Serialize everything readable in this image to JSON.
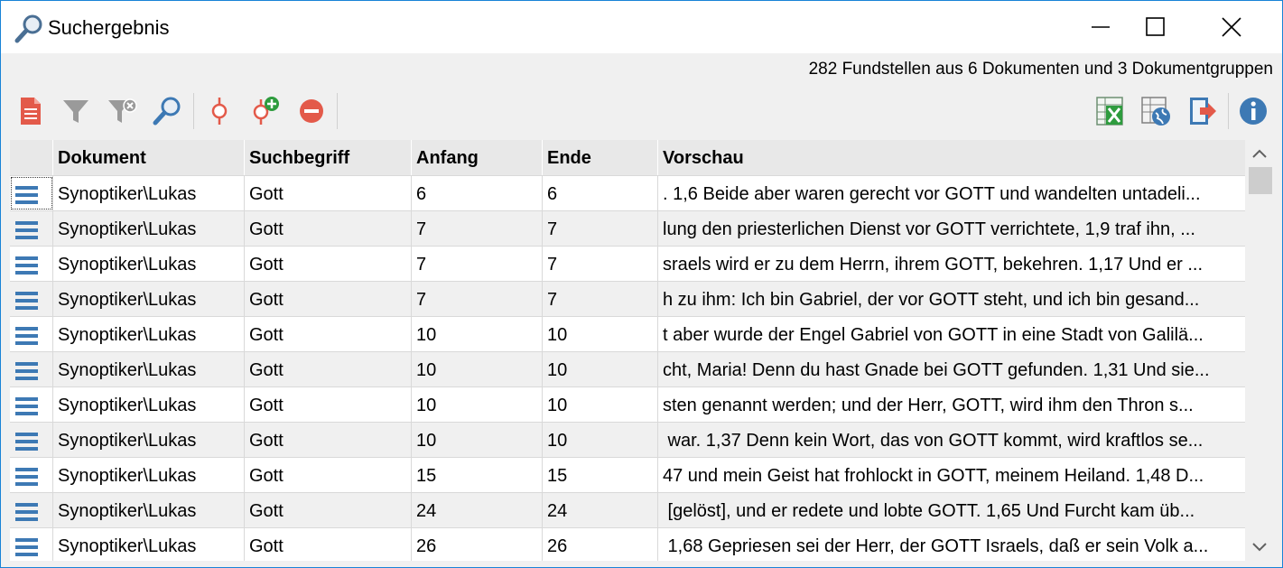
{
  "window": {
    "title": "Suchergebnis",
    "controls": [
      "minimize",
      "maximize",
      "close"
    ]
  },
  "summary": "282 Fundstellen aus 6 Dokumenten und 3 Dokumentgruppen",
  "toolbar": {
    "left_icons": [
      "document-list-icon",
      "filter-icon",
      "filter-remove-icon",
      "search-icon",
      "search-point-icon",
      "search-point-add-icon",
      "remove-icon"
    ],
    "right_icons": [
      "excel-export-icon",
      "web-export-icon",
      "export-arrow-icon",
      "info-icon"
    ]
  },
  "colors": {
    "accent_blue": "#3d79b4",
    "red": "#e35a4a",
    "green": "#2e9c3e",
    "border": "#1883d7"
  },
  "table": {
    "columns": [
      "",
      "Dokument",
      "Suchbegriff",
      "Anfang",
      "Ende",
      "Vorschau"
    ],
    "rows": [
      {
        "dokument": "Synoptiker\\Lukas",
        "suchbegriff": "Gott",
        "anfang": "6",
        "ende": "6",
        "vorschau": ". 1,6 Beide aber waren gerecht vor GOTT und wandelten untadeli..."
      },
      {
        "dokument": "Synoptiker\\Lukas",
        "suchbegriff": "Gott",
        "anfang": "7",
        "ende": "7",
        "vorschau": "lung den priesterlichen Dienst vor GOTT verrichtete, 1,9 traf ihn, ..."
      },
      {
        "dokument": "Synoptiker\\Lukas",
        "suchbegriff": "Gott",
        "anfang": "7",
        "ende": "7",
        "vorschau": "sraels wird er zu dem Herrn, ihrem GOTT, bekehren. 1,17 Und er ..."
      },
      {
        "dokument": "Synoptiker\\Lukas",
        "suchbegriff": "Gott",
        "anfang": "7",
        "ende": "7",
        "vorschau": "h zu ihm: Ich bin Gabriel, der vor GOTT steht, und ich bin gesand..."
      },
      {
        "dokument": "Synoptiker\\Lukas",
        "suchbegriff": "Gott",
        "anfang": "10",
        "ende": "10",
        "vorschau": "t aber wurde der Engel Gabriel von GOTT in eine Stadt von Galilä..."
      },
      {
        "dokument": "Synoptiker\\Lukas",
        "suchbegriff": "Gott",
        "anfang": "10",
        "ende": "10",
        "vorschau": "cht, Maria! Denn du hast Gnade bei GOTT gefunden. 1,31 Und sie..."
      },
      {
        "dokument": "Synoptiker\\Lukas",
        "suchbegriff": "Gott",
        "anfang": "10",
        "ende": "10",
        "vorschau": "sten genannt werden; und der Herr, GOTT, wird ihm den Thron s..."
      },
      {
        "dokument": "Synoptiker\\Lukas",
        "suchbegriff": "Gott",
        "anfang": "10",
        "ende": "10",
        "vorschau": " war. 1,37 Denn kein Wort, das von GOTT kommt, wird kraftlos se..."
      },
      {
        "dokument": "Synoptiker\\Lukas",
        "suchbegriff": "Gott",
        "anfang": "15",
        "ende": "15",
        "vorschau": "47 und mein Geist hat frohlockt in GOTT, meinem Heiland. 1,48 D..."
      },
      {
        "dokument": "Synoptiker\\Lukas",
        "suchbegriff": "Gott",
        "anfang": "24",
        "ende": "24",
        "vorschau": " [gelöst], und er redete und lobte GOTT. 1,65 Und Furcht kam üb..."
      },
      {
        "dokument": "Synoptiker\\Lukas",
        "suchbegriff": "Gott",
        "anfang": "26",
        "ende": "26",
        "vorschau": " 1,68 Gepriesen sei der Herr, der GOTT Israels, daß er sein Volk a..."
      }
    ]
  }
}
